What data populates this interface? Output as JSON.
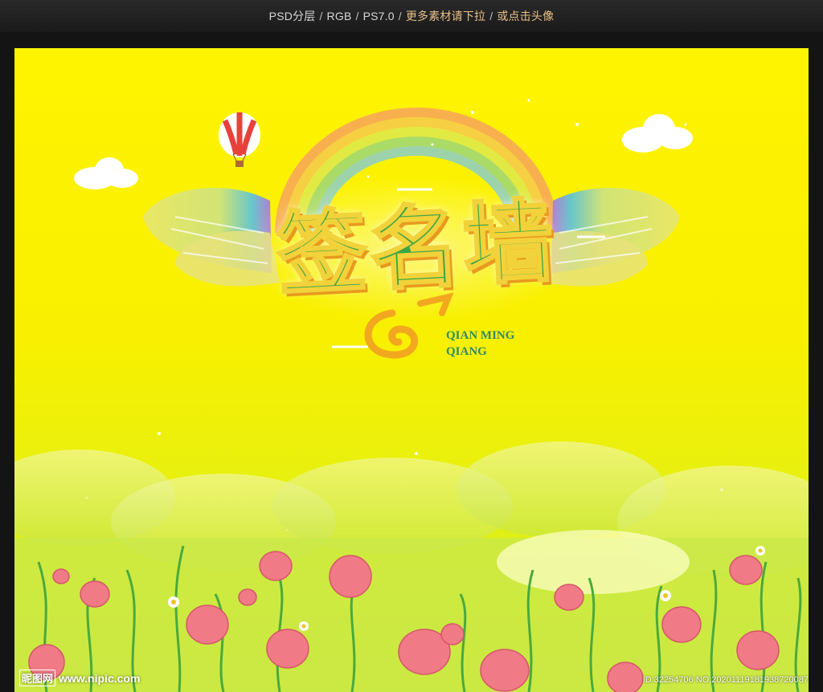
{
  "header": {
    "segments": [
      "PSD分层",
      "RGB",
      "PS7.0"
    ],
    "accent_text": "更多素材请下拉",
    "tail_text": "或点击头像",
    "separator": "/"
  },
  "artwork": {
    "title_cn": "签名墙",
    "title_pinyin_line1": "QIAN MING",
    "title_pinyin_line2": "QIANG",
    "colors": {
      "background": "#fff400",
      "title_green": "#3ca544",
      "title_outline": "#f2d23a",
      "flower_pink": "#f07a86"
    },
    "icons": [
      "hot-air-balloon-icon",
      "rainbow-icon",
      "wing-icon",
      "cloud-icon",
      "flower-icon"
    ]
  },
  "watermark": {
    "site_logo": "昵图网",
    "site_url": "www.nipic.com",
    "id_text": "ID:32254706 NO:20201119181938720087"
  }
}
